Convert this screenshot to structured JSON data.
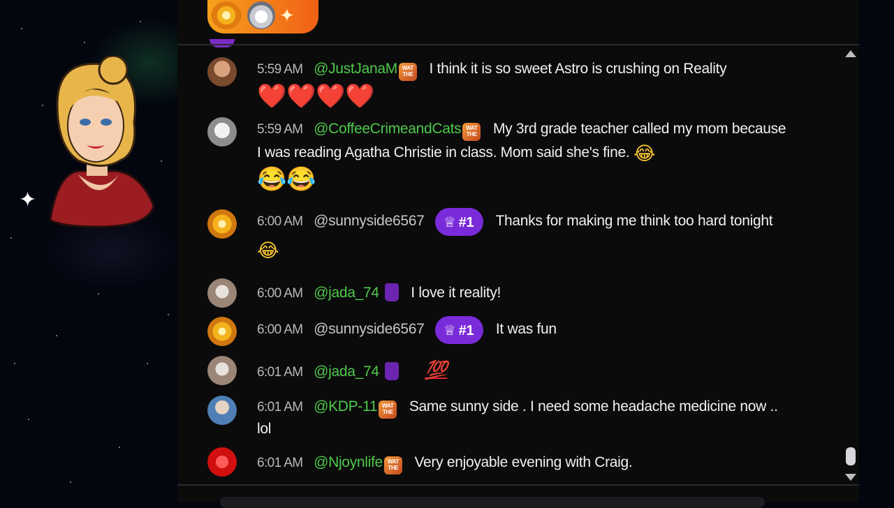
{
  "messages": [
    {
      "time": "5:59 AM",
      "user": "@JustJanaM",
      "badge": "wat",
      "text": "I think it is so sweet Astro is crushing on Reality",
      "extra_emoji": "❤️❤️❤️❤️"
    },
    {
      "time": "5:59 AM",
      "user": "@CoffeeCrimeandCats",
      "badge": "wat",
      "text": "My 3rd grade teacher called my mom because I was reading Agatha Christie in class. Mom said she's fine.",
      "inline_emoji": "😂",
      "extra_emoji": "😂😂"
    },
    {
      "time": "6:00 AM",
      "user": "@sunnyside6567",
      "rank": "#1",
      "text": "Thanks for making me think too hard tonight",
      "inline_emoji": "😂"
    },
    {
      "time": "6:00 AM",
      "user": "@jada_74",
      "badge": "purple",
      "text": "I love it reality!"
    },
    {
      "time": "6:00 AM",
      "user": "@sunnyside6567",
      "rank": "#1",
      "text": "It was fun"
    },
    {
      "time": "6:01 AM",
      "user": "@jada_74",
      "badge": "purple",
      "text": "",
      "emoji": "💯"
    },
    {
      "time": "6:01 AM",
      "user": "@KDP-11",
      "badge": "wat",
      "text": "Same sunny side . I need some headache medicine now .. lol"
    },
    {
      "time": "6:01 AM",
      "user": "@Njoynlife",
      "badge": "wat",
      "text": "Very enjoyable evening with Craig."
    }
  ],
  "badges": {
    "wat_label": "WAT THE"
  },
  "colors": {
    "username_green": "#4fc94a",
    "rank_badge": "#7a2bd9",
    "top_pill": "#f06016"
  },
  "icons": [
    "spiral-avatar-icon",
    "robot-emoji-icon",
    "sparkles-icon",
    "crown-icon",
    "scroll-up-icon",
    "scroll-down-icon",
    "cursor-icon"
  ]
}
